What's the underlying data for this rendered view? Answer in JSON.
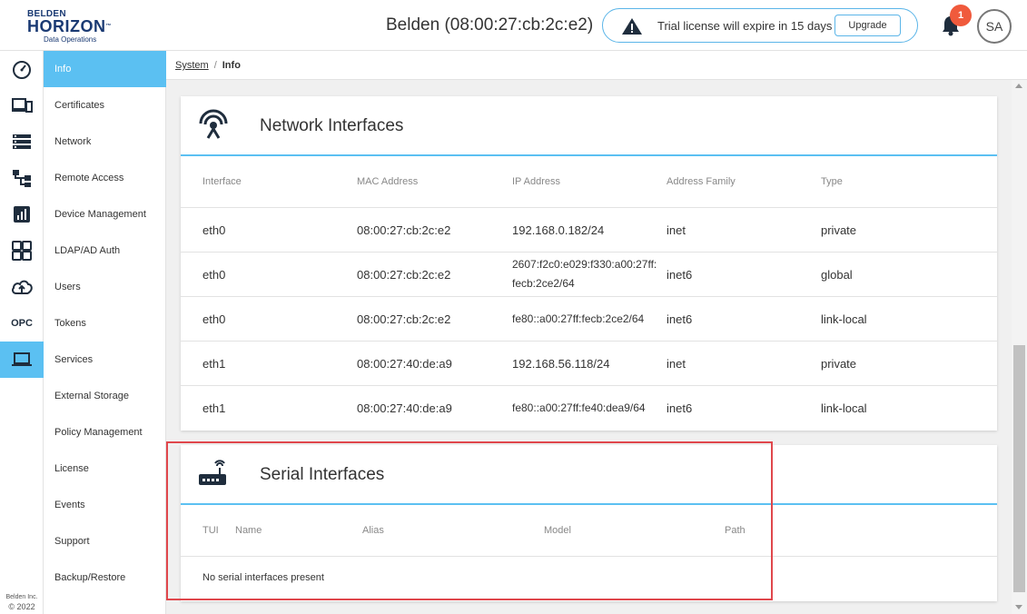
{
  "header": {
    "logo": {
      "line1": "BELDEN",
      "line2": "HORIZON",
      "tm": "™",
      "line3": "Data Operations"
    },
    "device_title": "Belden (08:00:27:cb:2c:e2)",
    "license_text": "Trial license will expire in 15 days",
    "upgrade_label": "Upgrade",
    "notification_count": "1",
    "avatar_initials": "SA"
  },
  "rail": {
    "items": [
      {
        "icon": "speedometer-icon"
      },
      {
        "icon": "devices-icon"
      },
      {
        "icon": "list-icon"
      },
      {
        "icon": "hierarchy-icon"
      },
      {
        "icon": "chart-icon"
      },
      {
        "icon": "grid-icon"
      },
      {
        "icon": "cloud-upload-icon"
      },
      {
        "icon": "opc-icon",
        "label": "OPC"
      },
      {
        "icon": "laptop-icon",
        "active": true
      }
    ],
    "footer_company": "Belden Inc.",
    "footer_copyright": "© 2022"
  },
  "menu": {
    "items": [
      "Info",
      "Certificates",
      "Network",
      "Remote Access",
      "Device Management",
      "LDAP/AD Auth",
      "Users",
      "Tokens",
      "Services",
      "External Storage",
      "Policy Management",
      "License",
      "Events",
      "Support",
      "Backup/Restore"
    ],
    "active": "Info"
  },
  "breadcrumb": {
    "parent": "System",
    "separator": "/",
    "current": "Info"
  },
  "network": {
    "title": "Network Interfaces",
    "columns": [
      "Interface",
      "MAC Address",
      "IP Address",
      "Address Family",
      "Type"
    ],
    "rows": [
      {
        "interface": "eth0",
        "mac": "08:00:27:cb:2c:e2",
        "ip": "192.168.0.182/24",
        "ip2": "",
        "family": "inet",
        "type": "private"
      },
      {
        "interface": "eth0",
        "mac": "08:00:27:cb:2c:e2",
        "ip": "2607:f2c0:e029:f330:a00:27ff:",
        "ip2": "fecb:2ce2/64",
        "family": "inet6",
        "type": "global"
      },
      {
        "interface": "eth0",
        "mac": "08:00:27:cb:2c:e2",
        "ip": "fe80::a00:27ff:fecb:2ce2/64",
        "ip2": "",
        "family": "inet6",
        "type": "link-local"
      },
      {
        "interface": "eth1",
        "mac": "08:00:27:40:de:a9",
        "ip": "192.168.56.118/24",
        "ip2": "",
        "family": "inet",
        "type": "private"
      },
      {
        "interface": "eth1",
        "mac": "08:00:27:40:de:a9",
        "ip": "fe80::a00:27ff:fe40:dea9/64",
        "ip2": "",
        "family": "inet6",
        "type": "link-local"
      }
    ]
  },
  "serial": {
    "title": "Serial Interfaces",
    "columns": [
      "TUI",
      "Name",
      "Alias",
      "Model",
      "Path"
    ],
    "empty_message": "No serial interfaces present"
  },
  "colors": {
    "accent": "#5bc0f2",
    "brand": "#1a3a73",
    "badge": "#f05a3c",
    "highlight": "#e0474c"
  }
}
